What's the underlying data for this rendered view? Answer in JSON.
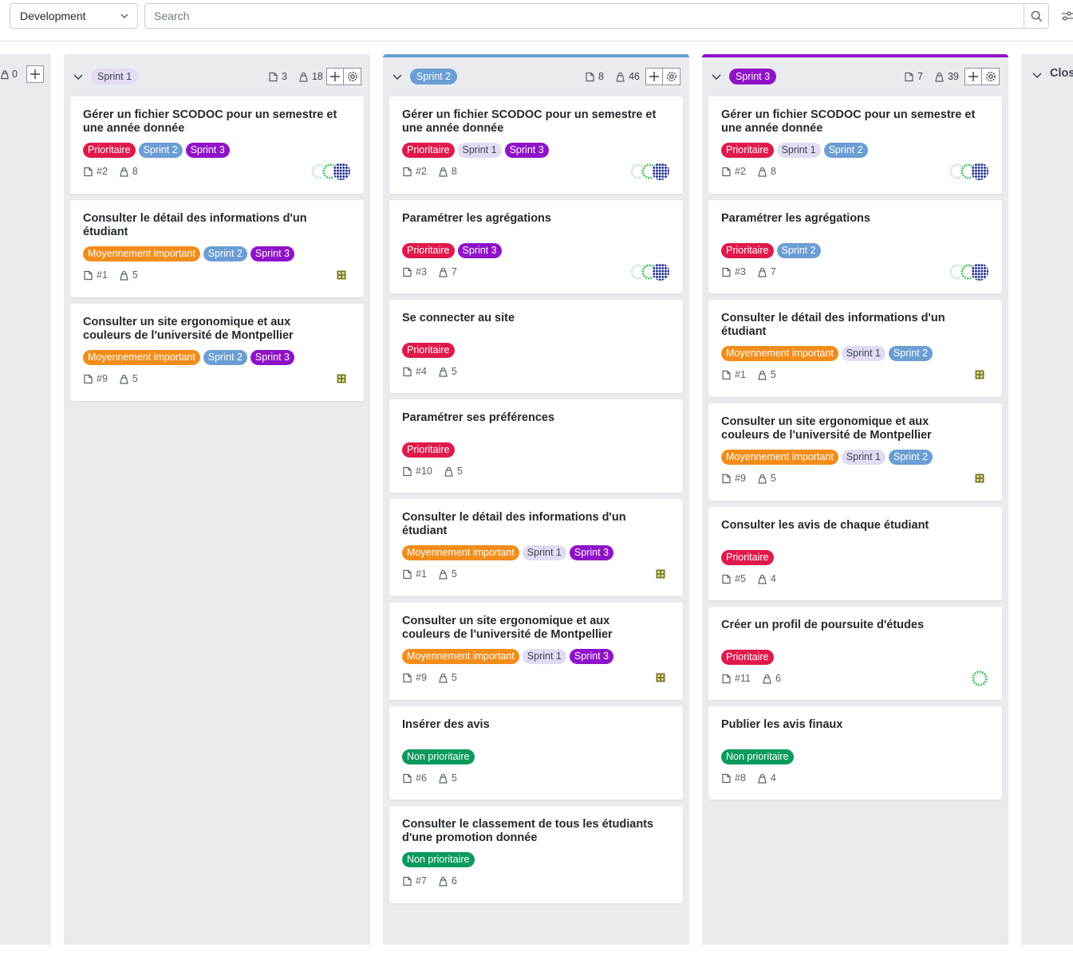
{
  "topbar": {
    "project_select": "Development",
    "search_placeholder": "Search"
  },
  "colors": {
    "prioritaire": "#e0194b",
    "moyen": "#f28c1a",
    "non_prioritaire": "#0a9a5c",
    "sprint1": "#e1dcf2",
    "sprint2": "#6a9ed4",
    "sprint3": "#8f12c9"
  },
  "left_partial": {
    "points": "0"
  },
  "closed_partial": {
    "label": "Clos"
  },
  "columns": [
    {
      "name": "Sprint 1",
      "stories": "3",
      "points": "18",
      "cards": [
        {
          "title": "Gérer un fichier SCODOC pour un semestre et une année donnée",
          "tags": [
            "Prioritaire",
            "Sprint 2",
            "Sprint 3"
          ],
          "id": "#2",
          "points": "8",
          "avatars": "multi"
        },
        {
          "title": "Consulter le détail des informations d'un étudiant",
          "tags": [
            "Moyennement important",
            "Sprint 2",
            "Sprint 3"
          ],
          "id": "#1",
          "points": "5",
          "avatars": "single"
        },
        {
          "title": "Consulter un site ergonomique et aux couleurs de l'université de Montpellier",
          "tags": [
            "Moyennement important",
            "Sprint 2",
            "Sprint 3"
          ],
          "id": "#9",
          "points": "5",
          "avatars": "single"
        }
      ]
    },
    {
      "name": "Sprint 2",
      "stories": "8",
      "points": "46",
      "cards": [
        {
          "title": "Gérer un fichier SCODOC pour un semestre et une année donnée",
          "tags": [
            "Prioritaire",
            "Sprint 1",
            "Sprint 3"
          ],
          "id": "#2",
          "points": "8",
          "avatars": "multi"
        },
        {
          "title": "Paramétrer les agrégations",
          "tags": [
            "Prioritaire",
            "Sprint 3"
          ],
          "id": "#3",
          "points": "7",
          "avatars": "multi"
        },
        {
          "title": "Se connecter au site",
          "tags": [
            "Prioritaire"
          ],
          "id": "#4",
          "points": "5",
          "avatars": ""
        },
        {
          "title": "Paramétrer ses préférences",
          "tags": [
            "Prioritaire"
          ],
          "id": "#10",
          "points": "5",
          "avatars": ""
        },
        {
          "title": "Consulter le détail des informations d'un étudiant",
          "tags": [
            "Moyennement important",
            "Sprint 1",
            "Sprint 3"
          ],
          "id": "#1",
          "points": "5",
          "avatars": "single"
        },
        {
          "title": "Consulter un site ergonomique et aux couleurs de l'université de Montpellier",
          "tags": [
            "Moyennement important",
            "Sprint 1",
            "Sprint 3"
          ],
          "id": "#9",
          "points": "5",
          "avatars": "single"
        },
        {
          "title": "Insérer des avis",
          "tags": [
            "Non prioritaire"
          ],
          "id": "#6",
          "points": "5",
          "avatars": ""
        },
        {
          "title": "Consulter le classement de tous les étudiants d'une promotion donnée",
          "tags": [
            "Non prioritaire"
          ],
          "id": "#7",
          "points": "6",
          "avatars": ""
        }
      ]
    },
    {
      "name": "Sprint 3",
      "stories": "7",
      "points": "39",
      "cards": [
        {
          "title": "Gérer un fichier SCODOC pour un semestre et une année donnée",
          "tags": [
            "Prioritaire",
            "Sprint 1",
            "Sprint 2"
          ],
          "id": "#2",
          "points": "8",
          "avatars": "multi"
        },
        {
          "title": "Paramétrer les agrégations",
          "tags": [
            "Prioritaire",
            "Sprint 2"
          ],
          "id": "#3",
          "points": "7",
          "avatars": "multi"
        },
        {
          "title": "Consulter le détail des informations d'un étudiant",
          "tags": [
            "Moyennement important",
            "Sprint 1",
            "Sprint 2"
          ],
          "id": "#1",
          "points": "5",
          "avatars": "single"
        },
        {
          "title": "Consulter un site ergonomique et aux couleurs de l'université de Montpellier",
          "tags": [
            "Moyennement important",
            "Sprint 1",
            "Sprint 2"
          ],
          "id": "#9",
          "points": "5",
          "avatars": "single"
        },
        {
          "title": "Consulter les avis de chaque étudiant",
          "tags": [
            "Prioritaire"
          ],
          "id": "#5",
          "points": "4",
          "avatars": ""
        },
        {
          "title": "Créer un profil de poursuite d'études",
          "tags": [
            "Prioritaire"
          ],
          "id": "#11",
          "points": "6",
          "avatars": "green"
        },
        {
          "title": "Publier les avis finaux",
          "tags": [
            "Non prioritaire"
          ],
          "id": "#8",
          "points": "4",
          "avatars": ""
        }
      ]
    }
  ]
}
